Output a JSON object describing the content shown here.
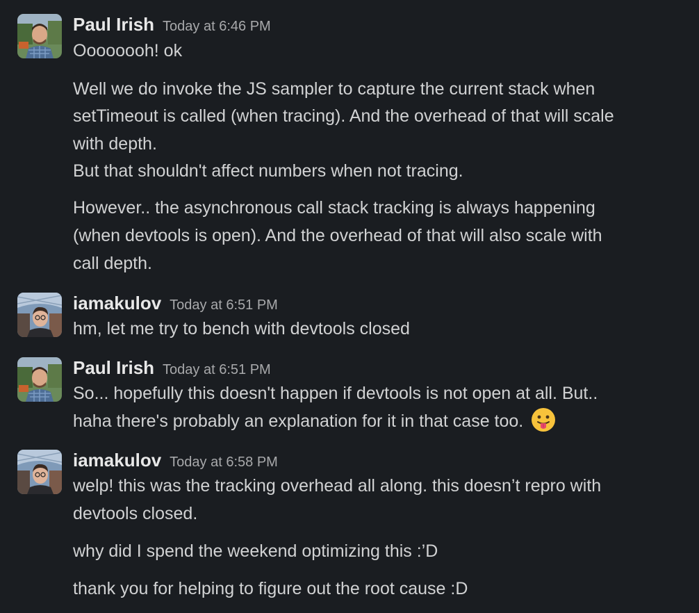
{
  "messages": [
    {
      "author": "Paul Irish",
      "timestamp": "Today at 6:46 PM",
      "lines": [
        "Oooooooh! ok",
        "Well we do invoke the JS sampler to capture the current stack when",
        "setTimeout is called (when tracing). And the overhead of that will scale",
        "with depth.",
        "But that shouldn't affect numbers when not tracing.",
        "However.. the asynchronous call stack tracking is always happening",
        "(when devtools is open). And the overhead of that will also scale with",
        "call depth."
      ]
    },
    {
      "author": "iamakulov",
      "timestamp": "Today at 6:51 PM",
      "lines": [
        "hm, let me try to bench with devtools closed"
      ]
    },
    {
      "author": "Paul Irish",
      "timestamp": "Today at 6:51 PM",
      "lines": [
        "So... hopefully this doesn't happen if devtools is not open at all.  But..",
        "haha there's probably an explanation for it in that case too."
      ],
      "emoji": "tongue-out-emoji"
    },
    {
      "author": "iamakulov",
      "timestamp": "Today at 6:58 PM",
      "lines": [
        "welp! this was the tracking overhead all along. this doesn’t repro with",
        "devtools closed.",
        "why did I spend the weekend optimizing this :’D",
        "thank you for helping to figure out the root cause :D"
      ]
    }
  ]
}
